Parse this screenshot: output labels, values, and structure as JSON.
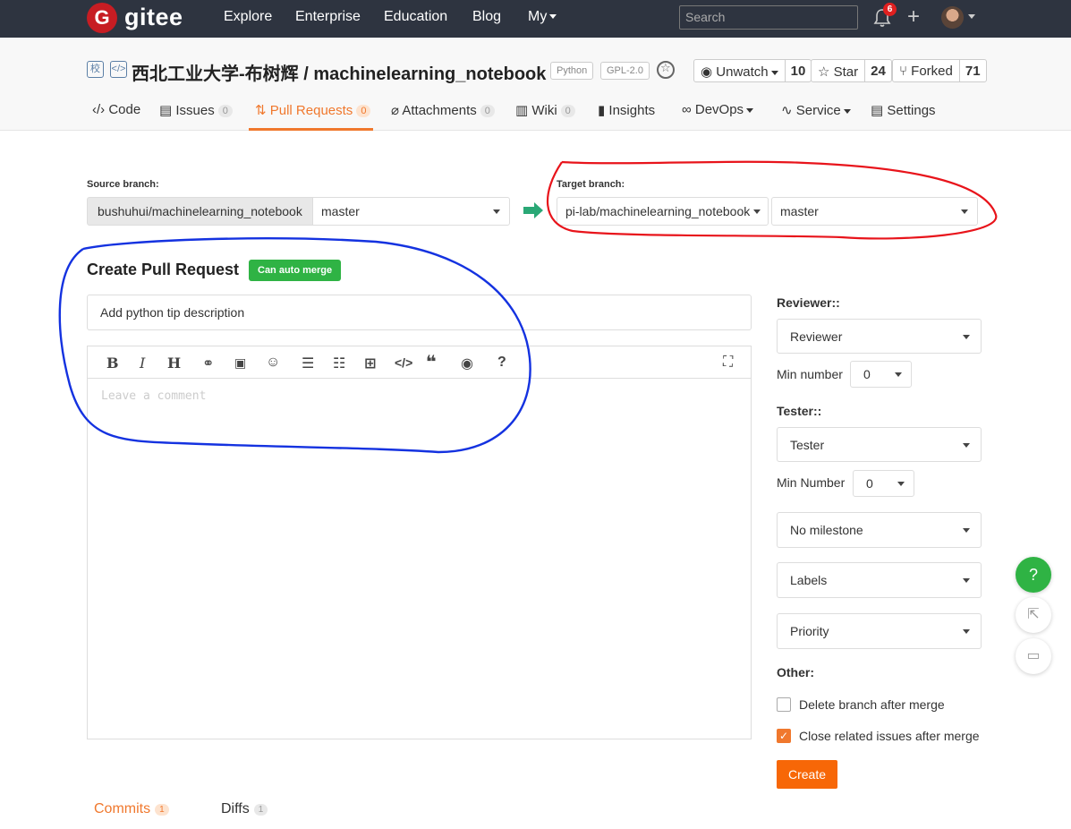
{
  "nav": {
    "logo_letter": "G",
    "logo_text": "gitee",
    "links": [
      "Explore",
      "Enterprise",
      "Education",
      "Blog",
      "My"
    ],
    "search_placeholder": "Search",
    "notif_count": "6",
    "plus": "+"
  },
  "repo": {
    "school_tag": "校",
    "code_tag": "</>",
    "title": "西北工业大学-布树辉 / machinelearning_notebook",
    "lang": "Python",
    "license": "GPL-2.0",
    "watch": {
      "label": "Unwatch",
      "count": "10"
    },
    "star": {
      "label": "Star",
      "count": "24"
    },
    "fork": {
      "label": "Forked",
      "count": "71"
    }
  },
  "tabs": {
    "code": "Code",
    "issues": "Issues",
    "issues_count": "0",
    "pulls": "Pull Requests",
    "pulls_count": "0",
    "attachments": "Attachments",
    "attachments_count": "0",
    "wiki": "Wiki",
    "wiki_count": "0",
    "insights": "Insights",
    "devops": "DevOps",
    "service": "Service",
    "settings": "Settings"
  },
  "branches": {
    "source_label": "Source branch:",
    "source_repo": "bushuhui/machinelearning_notebook",
    "source_branch": "master",
    "target_label": "Target branch:",
    "target_repo": "pi-lab/machinelearning_notebook",
    "target_branch": "master"
  },
  "form": {
    "heading": "Create Pull Request",
    "merge_badge": "Can auto merge",
    "title_value": "Add python tip description",
    "comment_placeholder": "Leave a comment",
    "toolbar": [
      "bold-icon",
      "italic-icon",
      "heading-icon",
      "link-icon",
      "image-icon",
      "emoji-icon",
      "bullet-list-icon",
      "numbered-list-icon",
      "table-icon",
      "code-icon",
      "quote-icon",
      "preview-icon",
      "help-icon",
      "fullscreen-icon"
    ]
  },
  "sidebar": {
    "reviewer_label": "Reviewer::",
    "reviewer_select": "Reviewer",
    "reviewer_min_label": "Min number",
    "reviewer_min_value": "0",
    "tester_label": "Tester::",
    "tester_select": "Tester",
    "tester_min_label": "Min Number",
    "tester_min_value": "0",
    "milestone": "No milestone",
    "labels": "Labels",
    "priority": "Priority",
    "other_label": "Other:",
    "delete_branch": "Delete branch after merge",
    "delete_branch_checked": false,
    "close_issues": "Close related issues after merge",
    "close_issues_checked": true,
    "create_button": "Create"
  },
  "bottom_tabs": {
    "commits": "Commits",
    "commits_count": "1",
    "diffs": "Diffs",
    "diffs_count": "1"
  },
  "floating": {
    "help": "?"
  },
  "colors": {
    "accent": "#f0782d",
    "nav_bg": "#2e3440",
    "success": "#2fb344",
    "annotation_red": "#e8141b",
    "annotation_blue": "#1432e0"
  }
}
